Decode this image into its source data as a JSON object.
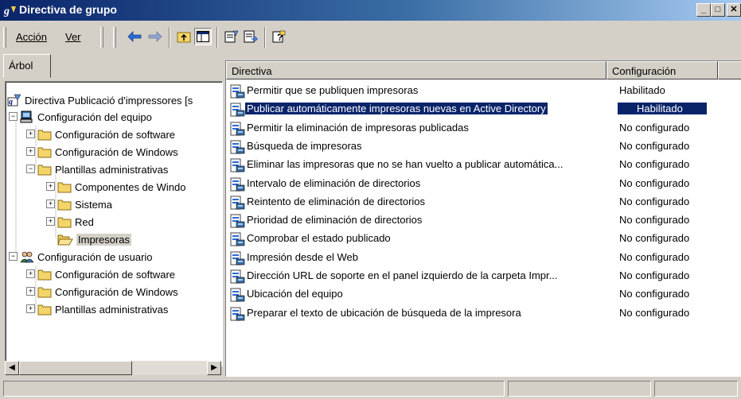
{
  "window": {
    "title": "Directiva de grupo"
  },
  "window_controls": {
    "minimize": "_",
    "maximize": "□",
    "close": "✕"
  },
  "menu": {
    "action": "Acción",
    "view": "Ver"
  },
  "tab": {
    "label": "Árbol"
  },
  "tree": [
    {
      "label": "Directiva Publicació d'impressores [s",
      "icon": "policy-icon",
      "level": 0,
      "expander": ""
    },
    {
      "label": "Configuración del equipo",
      "icon": "computer-icon",
      "level": 0,
      "expander": "−"
    },
    {
      "label": "Configuración de software",
      "icon": "folder-icon",
      "level": 1,
      "expander": "+"
    },
    {
      "label": "Configuración de Windows",
      "icon": "folder-icon",
      "level": 1,
      "expander": "+"
    },
    {
      "label": "Plantillas administrativas",
      "icon": "folder-icon",
      "level": 1,
      "expander": "−"
    },
    {
      "label": "Componentes de Windo",
      "icon": "folder-icon",
      "level": 2,
      "expander": "+"
    },
    {
      "label": "Sistema",
      "icon": "folder-icon",
      "level": 2,
      "expander": "+"
    },
    {
      "label": "Red",
      "icon": "folder-icon",
      "level": 2,
      "expander": "+"
    },
    {
      "label": "Impresoras",
      "icon": "folder-open-icon",
      "level": 2,
      "expander": "",
      "selected": true
    },
    {
      "label": "Configuración de usuario",
      "icon": "user-icon",
      "level": 0,
      "expander": "−"
    },
    {
      "label": "Configuración de software",
      "icon": "folder-icon",
      "level": 1,
      "expander": "+"
    },
    {
      "label": "Configuración de Windows",
      "icon": "folder-icon",
      "level": 1,
      "expander": "+"
    },
    {
      "label": "Plantillas administrativas",
      "icon": "folder-icon",
      "level": 1,
      "expander": "+"
    }
  ],
  "scroll": {
    "left": "◀",
    "right": "▶"
  },
  "list": {
    "columns": {
      "policy": "Directiva",
      "setting": "Configuración"
    },
    "rows": [
      {
        "name": "Permitir que se publiquen impresoras",
        "setting": "Habilitado"
      },
      {
        "name": "Publicar automáticamente impresoras nuevas en Active Directory",
        "setting": "Habilitado",
        "selected": true
      },
      {
        "name": "Permitir la eliminación de impresoras publicadas",
        "setting": "No configurado"
      },
      {
        "name": "Búsqueda de impresoras",
        "setting": "No configurado"
      },
      {
        "name": "Eliminar las impresoras que no se han vuelto a publicar automática...",
        "setting": "No configurado"
      },
      {
        "name": "Intervalo de eliminación de directorios",
        "setting": "No configurado"
      },
      {
        "name": "Reintento de eliminación de directorios",
        "setting": "No configurado"
      },
      {
        "name": "Prioridad de eliminación de directorios",
        "setting": "No configurado"
      },
      {
        "name": "Comprobar el estado publicado",
        "setting": "No configurado"
      },
      {
        "name": "Impresión desde el Web",
        "setting": "No configurado"
      },
      {
        "name": "Dirección URL de soporte en el panel izquierdo de la carpeta Impr...",
        "setting": "No configurado"
      },
      {
        "name": "Ubicación del equipo",
        "setting": "No configurado"
      },
      {
        "name": "Preparar el texto de ubicación de búsqueda de la impresora",
        "setting": "No configurado"
      }
    ]
  },
  "colors": {
    "titlebar_start": "#0a246a",
    "titlebar_end": "#a6caf0",
    "selection": "#0a246a",
    "face": "#d4d0c8"
  }
}
